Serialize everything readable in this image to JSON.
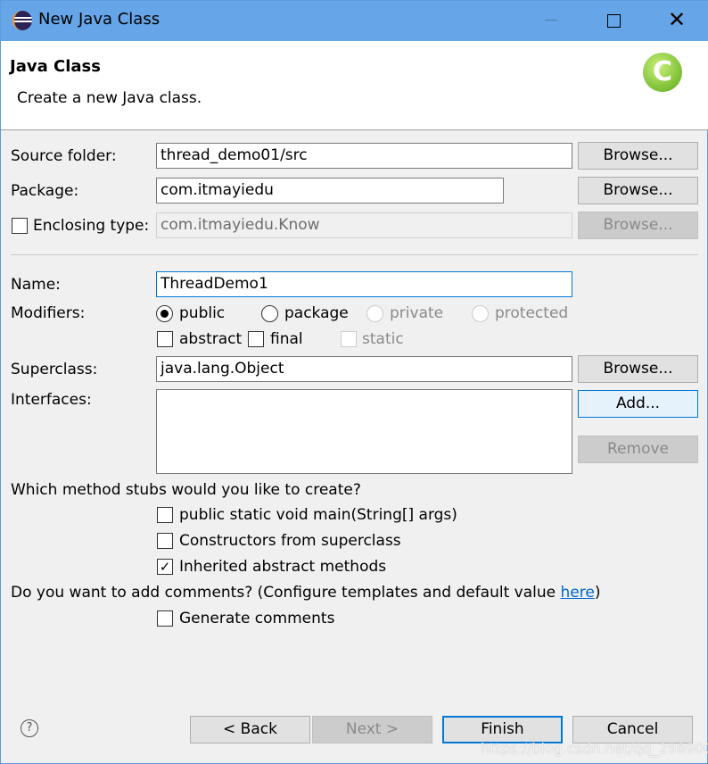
{
  "window": {
    "title": "New Java Class"
  },
  "header": {
    "title": "Java Class",
    "subtitle": "Create a new Java class."
  },
  "form": {
    "source_folder": {
      "label": "Source folder:",
      "value": "thread_demo01/src",
      "browse": "Browse..."
    },
    "package": {
      "label": "Package:",
      "value": "com.itmayiedu",
      "browse": "Browse..."
    },
    "enclosing": {
      "label": "Enclosing type:",
      "value": "com.itmayiedu.Know",
      "browse": "Browse...",
      "checked": false
    },
    "name": {
      "label": "Name:",
      "value": "ThreadDemo1"
    },
    "modifiers": {
      "label": "Modifiers:",
      "options": [
        "public",
        "package",
        "private",
        "protected"
      ],
      "selected": "public",
      "extras": [
        "abstract",
        "final",
        "static"
      ]
    },
    "superclass": {
      "label": "Superclass:",
      "value": "java.lang.Object",
      "browse": "Browse..."
    },
    "interfaces": {
      "label": "Interfaces:",
      "add": "Add...",
      "remove": "Remove"
    },
    "stubs": {
      "question": "Which method stubs would you like to create?",
      "items": [
        {
          "label": "public static void main(String[] args)",
          "checked": false
        },
        {
          "label": "Constructors from superclass",
          "checked": false
        },
        {
          "label": "Inherited abstract methods",
          "checked": true
        }
      ]
    },
    "comments": {
      "question": "Do you want to add comments? (Configure templates and default value ",
      "link": "here",
      "close": ")",
      "generate": "Generate comments",
      "checked": false
    }
  },
  "footer": {
    "back": "< Back",
    "next": "Next >",
    "finish": "Finish",
    "cancel": "Cancel"
  },
  "watermark": "https://blog.csdn.net/qq_29890029",
  "colors": {
    "titlebar": "#66a6e8",
    "accent": "#0078d7",
    "link": "#0066cc"
  }
}
